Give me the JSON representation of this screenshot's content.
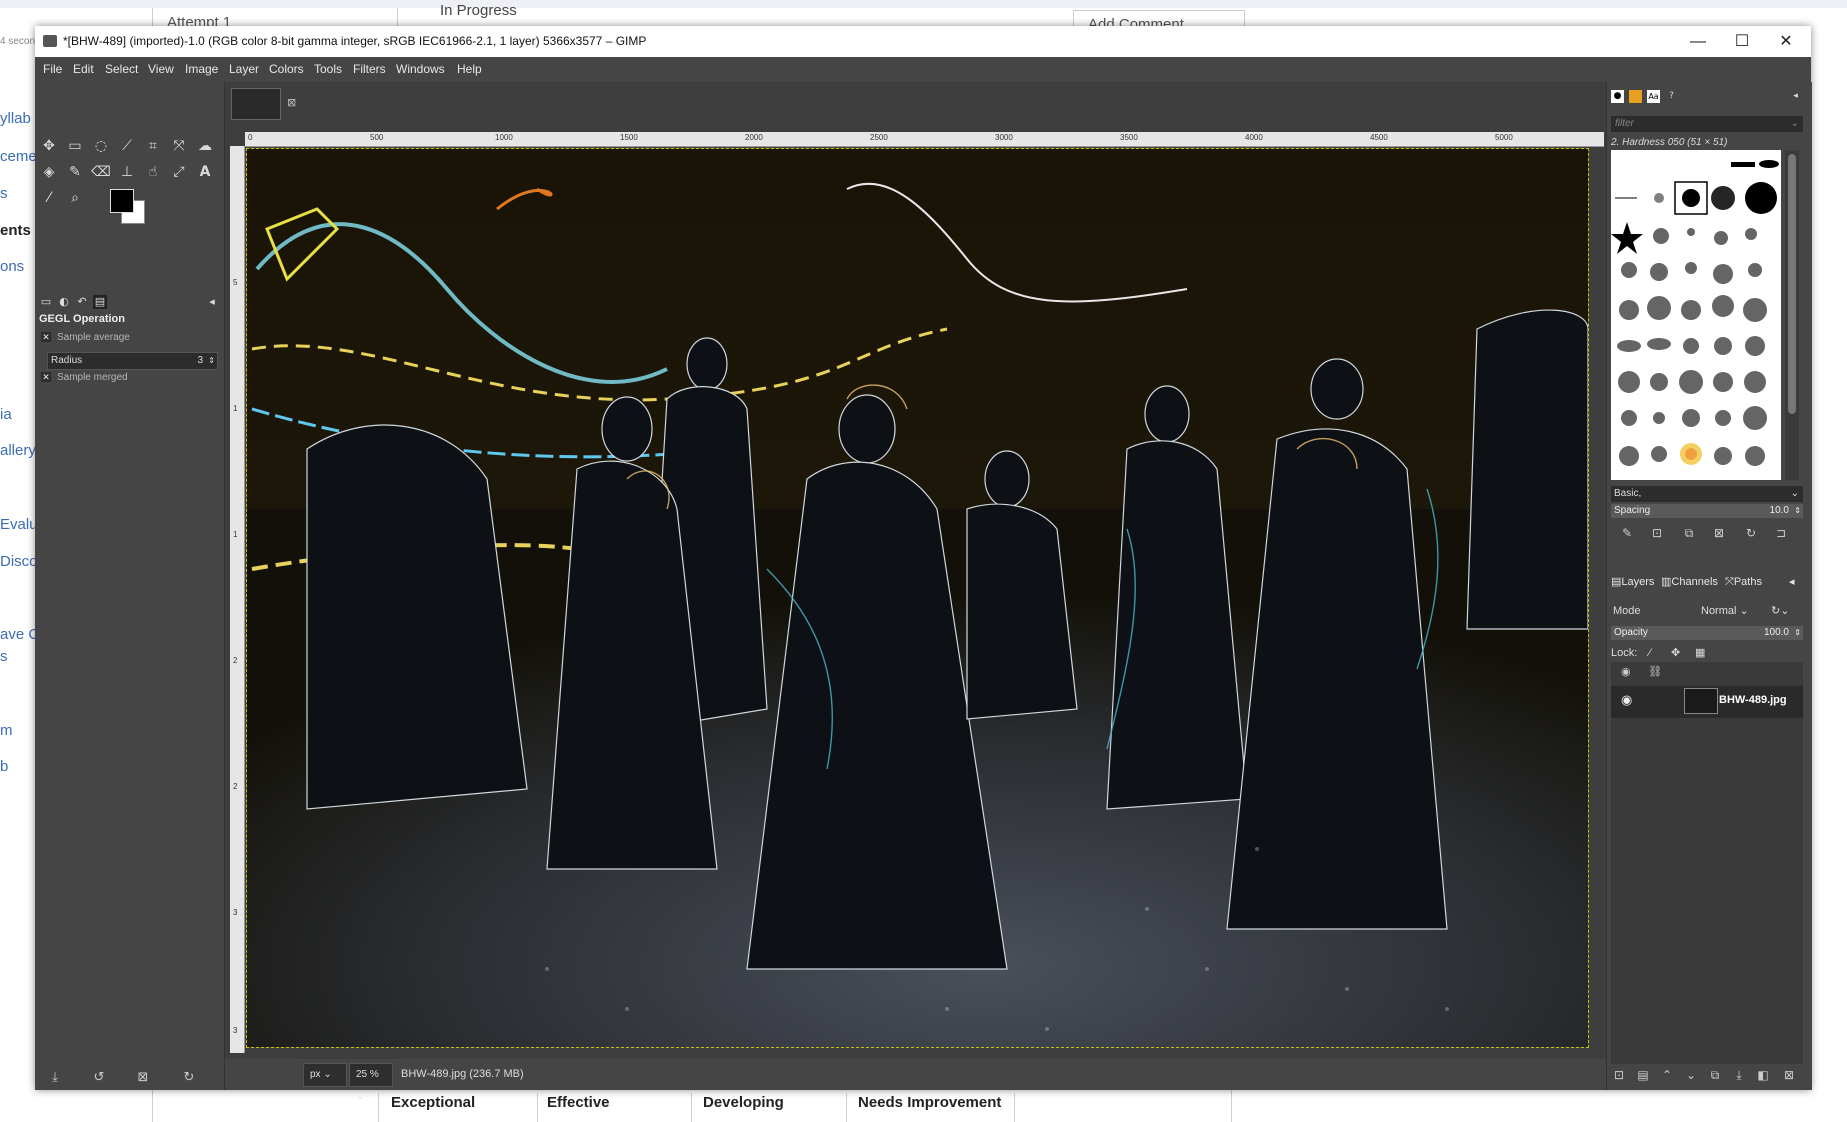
{
  "background_page": {
    "attempt_tab": "Attempt 1",
    "status": "In Progress",
    "add_comment": "Add Comment",
    "left_fragments": [
      "4 secon",
      "yllab",
      "ceme",
      "s",
      "ents",
      "ons",
      "ia",
      "allery",
      "Evalu",
      "Discov",
      "ave C",
      "s",
      "m",
      "b"
    ],
    "rubric_levels": [
      "Exceptional",
      "Effective",
      "Developing",
      "Needs Improvement"
    ]
  },
  "window": {
    "title": "*[BHW-489] (imported)-1.0 (RGB color 8-bit gamma integer, sRGB IEC61966-2.1, 1 layer) 5366x3577 – GIMP",
    "minimize": "—",
    "maximize": "☐",
    "close": "✕"
  },
  "menubar": [
    "File",
    "Edit",
    "Select",
    "View",
    "Image",
    "Layer",
    "Colors",
    "Tools",
    "Filters",
    "Windows",
    "Help"
  ],
  "toolbox": {
    "tool_icons": [
      "move-tool-icon",
      "rect-select-icon",
      "lasso-icon",
      "fuzzy-select-icon",
      "crop-icon",
      "transform-icon",
      "warp-icon",
      "bucket-fill-icon",
      "paintbrush-icon",
      "eraser-icon",
      "clone-icon",
      "smudge-icon",
      "paths-icon",
      "text-icon",
      "color-picker-icon",
      "zoom-icon"
    ],
    "options_title": "GEGL Operation",
    "sample_average": "Sample average",
    "radius_label": "Radius",
    "radius_value": "3",
    "sample_merged": "Sample merged"
  },
  "canvas": {
    "ruler_labels": [
      "0",
      "500",
      "1000",
      "1500",
      "2000",
      "2500",
      "3000",
      "3500",
      "4000",
      "4500",
      "5000"
    ],
    "ruler_v_labels": [
      "5",
      "1",
      "1",
      "2",
      "2",
      "3",
      "3"
    ],
    "unit": "px",
    "zoom": "25 %",
    "status_text": "BHW-489.jpg (236.7 MB)"
  },
  "brushes": {
    "filter_placeholder": "filter",
    "brush_name": "2. Hardness 050 (51 × 51)",
    "preset": "Basic,",
    "spacing_label": "Spacing",
    "spacing_value": "10.0"
  },
  "layers": {
    "tabs": [
      "Layers",
      "Channels",
      "Paths"
    ],
    "mode_label": "Mode",
    "mode_value": "Normal",
    "opacity_label": "Opacity",
    "opacity_value": "100.0",
    "lock_label": "Lock:",
    "layer_name": "BHW-489.jpg"
  },
  "colors": {
    "accent": "#c8c200",
    "ui_dark": "#454545",
    "link_blue": "#3b6db5"
  }
}
